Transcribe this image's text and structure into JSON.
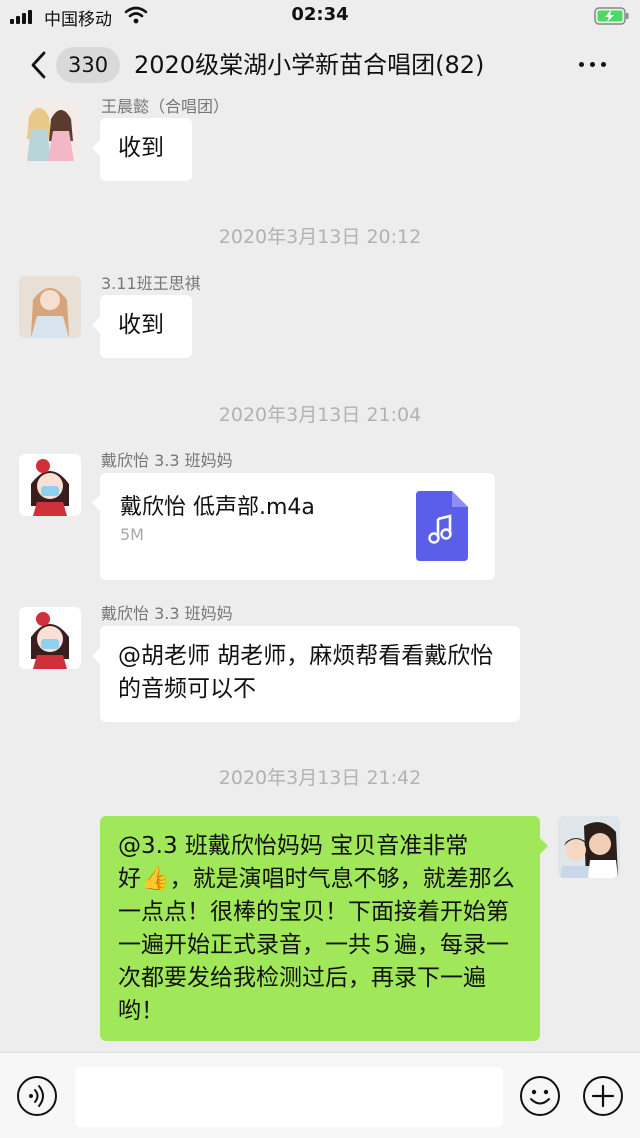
{
  "status_bar": {
    "carrier": "中国移动",
    "time": "02:34"
  },
  "nav": {
    "unread_count": "330",
    "title": "2020级棠湖小学新苗合唱团(82)"
  },
  "messages": {
    "m1": {
      "sender": "王晨懿（合唱团）",
      "text": "收到"
    },
    "t1": "2020年3月13日 20:12",
    "m2": {
      "sender": "3.11班王思祺",
      "text": "收到"
    },
    "t2": "2020年3月13日 21:04",
    "m3": {
      "sender": "戴欣怡 3.3 班妈妈",
      "file_name": "戴欣怡  低声部.m4a",
      "file_size": "5M"
    },
    "m4": {
      "sender": "戴欣怡 3.3 班妈妈",
      "text": "@胡老师 胡老师，麻烦帮看看戴欣怡的音频可以不"
    },
    "t3": "2020年3月13日 21:42",
    "m5": {
      "text_line1": "@3.3 班戴欣怡妈妈 宝贝音准非常",
      "text_line2a": "好",
      "text_line2b": "，就是演唱时气息不够，就",
      "text_rest": "差那么一点点！很棒的宝贝！下面接着开始第一遍开始正式录音，一共５遍，每录一次都要发给我检测过后，再录下一遍哟！"
    }
  },
  "icons": {
    "thumbs_up": "👍",
    "file_icon": "music-file-icon"
  },
  "colors": {
    "background": "#ededed",
    "outgoing_bubble": "#a0e75a",
    "file_icon": "#5b5ee8"
  }
}
